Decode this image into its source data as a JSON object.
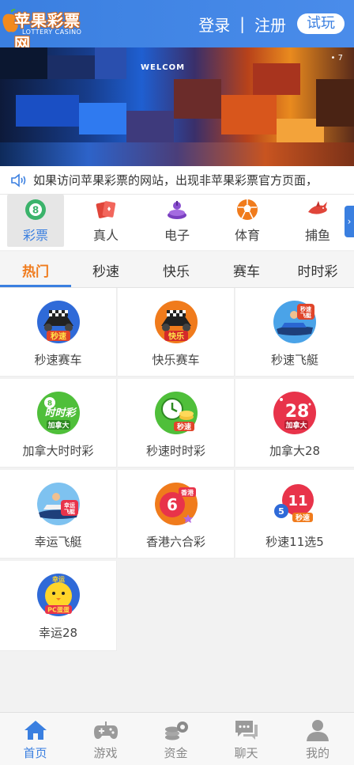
{
  "header": {
    "logo_text": "苹果彩票网",
    "logo_subtext": "LOTTERY CASINO",
    "login_label": "登录",
    "separator": "|",
    "register_label": "注册",
    "trial_label": "试玩"
  },
  "banner": {
    "text": "WELCOM",
    "corner_text": "• 7"
  },
  "notice": {
    "icon": "speaker-icon",
    "text": "如果访问苹果彩票的网站，出现非苹果彩票官方页面，"
  },
  "categories": [
    {
      "label": "彩票",
      "icon": "lottery-ball-icon",
      "active": true
    },
    {
      "label": "真人",
      "icon": "playing-cards-icon",
      "active": false
    },
    {
      "label": "电子",
      "icon": "slot-machine-icon",
      "active": false
    },
    {
      "label": "体育",
      "icon": "soccer-ball-icon",
      "active": false
    },
    {
      "label": "捕鱼",
      "icon": "shark-icon",
      "active": false
    }
  ],
  "subtabs": [
    {
      "label": "热门",
      "active": true
    },
    {
      "label": "秒速",
      "active": false
    },
    {
      "label": "快乐",
      "active": false
    },
    {
      "label": "赛车",
      "active": false
    },
    {
      "label": "时时彩",
      "active": false
    }
  ],
  "games": [
    {
      "label": "秒速赛车",
      "icon": "race-car-icon",
      "badge": "秒速"
    },
    {
      "label": "快乐赛车",
      "icon": "race-car-icon",
      "badge": "快乐"
    },
    {
      "label": "秒速飞艇",
      "icon": "jet-ski-icon",
      "badge": "秒速飞艇"
    },
    {
      "label": "加拿大时时彩",
      "icon": "lottery-ball-icon",
      "badge": "加拿大"
    },
    {
      "label": "秒速时时彩",
      "icon": "clock-coins-icon",
      "badge": "秒速"
    },
    {
      "label": "加拿大28",
      "icon": "ball-28-icon",
      "badge": "加拿大"
    },
    {
      "label": "幸运飞艇",
      "icon": "jet-ski-icon",
      "badge": "幸运飞艇"
    },
    {
      "label": "香港六合彩",
      "icon": "six-ball-icon",
      "badge": "香港"
    },
    {
      "label": "秒速11选5",
      "icon": "ball-11-icon",
      "badge": "秒速"
    },
    {
      "label": "幸运28",
      "icon": "chick-icon",
      "badge": "PC蛋蛋"
    }
  ],
  "bottom_nav": [
    {
      "label": "首页",
      "icon": "home-icon",
      "active": true
    },
    {
      "label": "游戏",
      "icon": "gamepad-icon",
      "active": false
    },
    {
      "label": "资金",
      "icon": "coins-icon",
      "active": false
    },
    {
      "label": "聊天",
      "icon": "chat-icon",
      "active": false
    },
    {
      "label": "我的",
      "icon": "user-icon",
      "active": false
    }
  ],
  "colors": {
    "primary": "#3a7fe0",
    "accent": "#f07b1c"
  }
}
